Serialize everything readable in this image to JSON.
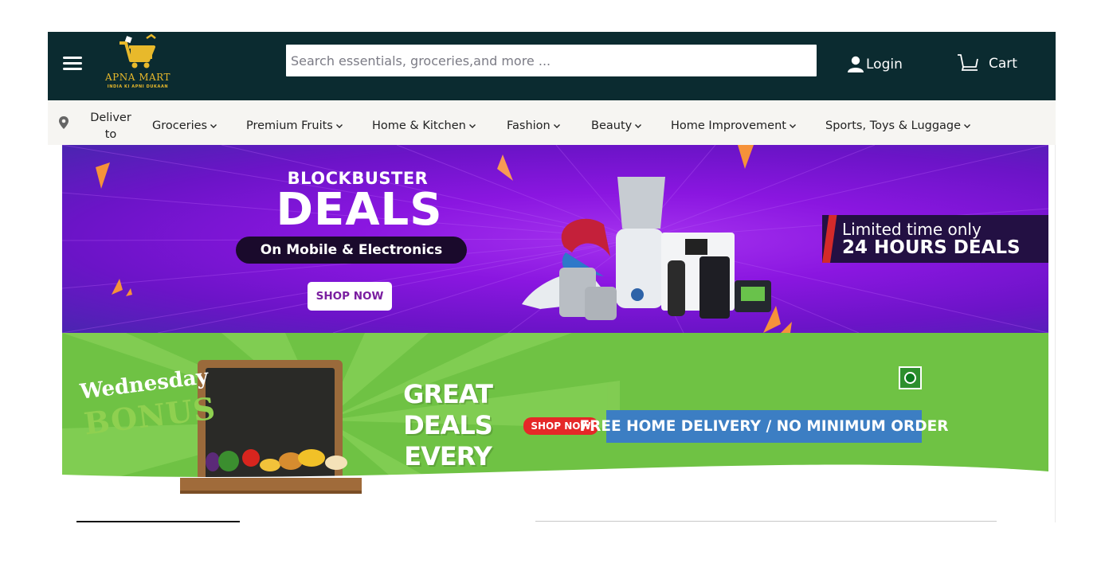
{
  "header": {
    "menu_icon": "hamburger-icon",
    "logo": {
      "name": "APNA MART",
      "tagline": "INDIA KI APNI DUKAAN",
      "icon": "shopping-cart-icon"
    },
    "search": {
      "placeholder": "Search essentials, groceries,and more ..."
    },
    "login": {
      "label": "Login",
      "icon": "user-icon"
    },
    "cart": {
      "label": "Cart",
      "icon": "cart-icon"
    }
  },
  "nav": {
    "location_icon": "location-pin-icon",
    "deliver": [
      "Deliver",
      "to"
    ],
    "items": [
      {
        "label": "Groceries"
      },
      {
        "label": "Premium Fruits"
      },
      {
        "label": "Home & Kitchen"
      },
      {
        "label": "Fashion"
      },
      {
        "label": "Beauty"
      },
      {
        "label": "Home Improvement"
      },
      {
        "label": "Sports, Toys & Luggage"
      }
    ]
  },
  "banner_electronics": {
    "title": "BLOCKBUSTER",
    "headline": "DEALS",
    "subtitle": "On Mobile & Electronics",
    "cta": "SHOP NOW",
    "limited_line1": "Limited time only",
    "limited_line2": "24 HOURS DEALS",
    "colors": {
      "bg": "#8a16e0",
      "accent": "#f6923a"
    }
  },
  "banner_wednesday": {
    "board_line1": "Wednesday",
    "board_line2": "BONUS",
    "headline": "GREAT DEALS\nEVERY\nWEDNESDAY",
    "cta": "SHOP NOW",
    "delivery": "FREE HOME DELIVERY / NO MINIMUM ORDER",
    "veg_icon": "veg-mark-icon",
    "colors": {
      "bg": "#6fc244",
      "cta": "#e52828",
      "delivery_bg": "#3c7ec3"
    }
  }
}
